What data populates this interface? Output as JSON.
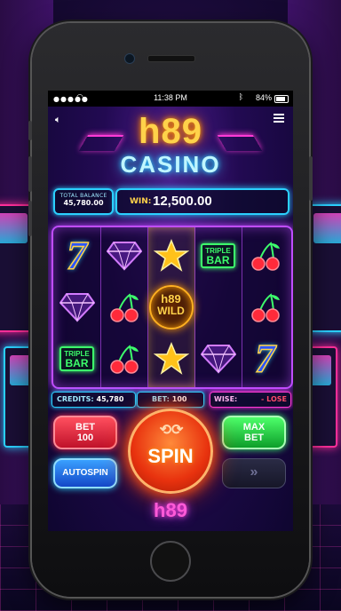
{
  "status_bar": {
    "time": "11:38 PM",
    "battery": "84%"
  },
  "logo": {
    "brand": "h89",
    "subtitle": "CASINO"
  },
  "balance": {
    "label": "TOTAL BALANCE",
    "value": "45,780.00"
  },
  "win": {
    "label": "WIN:",
    "value": "12,500.00"
  },
  "reels": {
    "symbols": [
      [
        "seven",
        "diamond",
        "star",
        "triple-bar",
        "cherry"
      ],
      [
        "diamond",
        "cherry",
        "wild",
        "",
        "cherry"
      ],
      [
        "triple-bar",
        "cherry",
        "star",
        "diamond",
        "seven"
      ]
    ],
    "seven_text": "7",
    "triple_bar_top": "TRIPLE",
    "triple_bar_bottom": "BAR",
    "wild_brand": "h89",
    "wild_label": "WILD"
  },
  "info": {
    "credits_label": "CREDITS:",
    "credits_value": "45,780",
    "bet_label": "BET:",
    "bet_value": "100",
    "wise_label": "WISE:",
    "wise_value": "- LOSE"
  },
  "buttons": {
    "bet_line1": "BET",
    "bet_line2": "100",
    "max_line1": "MAX",
    "max_line2": "BET",
    "autospin": "AUTOSPIN",
    "spin": "SPIN",
    "fast_forward": "»"
  },
  "footer": {
    "brand": "h89"
  },
  "colors": {
    "cyan": "#2bd0ff",
    "magenta": "#ff3ad6",
    "gold": "#ffd24a",
    "green": "#3dff6c",
    "red": "#ff2f4f"
  }
}
